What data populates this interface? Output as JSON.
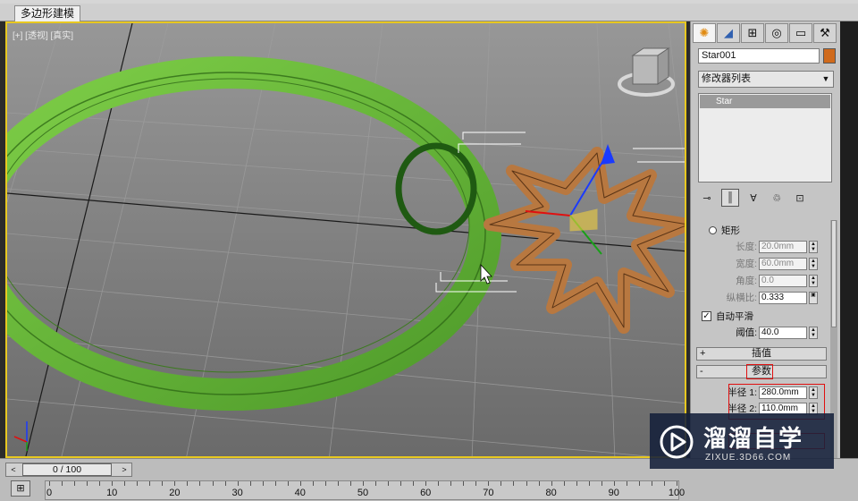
{
  "tabbar": {
    "active_tab": "多边形建模"
  },
  "viewport": {
    "label": "[+] [透视] [真实]"
  },
  "command_panel": {
    "tabs": [
      {
        "icon": "sun-icon",
        "active": true
      },
      {
        "icon": "modify-icon",
        "active": false
      },
      {
        "icon": "hierarchy-icon",
        "active": false
      },
      {
        "icon": "motion-icon",
        "active": false
      },
      {
        "icon": "display-icon",
        "active": false
      },
      {
        "icon": "hammer-icon",
        "active": false
      }
    ],
    "object_name": "Star001",
    "object_color": "#d06a1c",
    "modifier_list": "修改器列表",
    "stack_items": [
      "Star"
    ],
    "rect_option": "矩形",
    "length_label": "长度:",
    "length_value": "20.0mm",
    "width_label": "宽度:",
    "width_value": "60.0mm",
    "angle_label": "角度:",
    "angle_value": "0.0",
    "aspect_label": "纵横比:",
    "aspect_value": "0.333",
    "auto_smooth_label": "自动平滑",
    "auto_smooth_checked": true,
    "threshold_label": "阈值:",
    "threshold_value": "40.0",
    "rollout_interpolation": "插值",
    "rollout_interpolation_sign": "+",
    "rollout_parameters": "参数",
    "rollout_parameters_sign": "-",
    "radius1_label": "半径 1:",
    "radius1_value": "280.0mm",
    "radius2_label": "半径 2:",
    "radius2_value": "110.0mm"
  },
  "timeline": {
    "frame_display": "0 / 100",
    "current_frame": 0,
    "ruler_labels": [
      "0",
      "10",
      "20",
      "30",
      "40",
      "50",
      "60",
      "70",
      "80",
      "90",
      "100"
    ]
  },
  "watermark": {
    "title": "溜溜自学",
    "subtitle": "ZIXUE.3D66.COM"
  },
  "colors": {
    "viewport_border": "#e8c820",
    "ring": "#6bb83a",
    "star": "#b87840",
    "accent_red": "#e01010"
  }
}
